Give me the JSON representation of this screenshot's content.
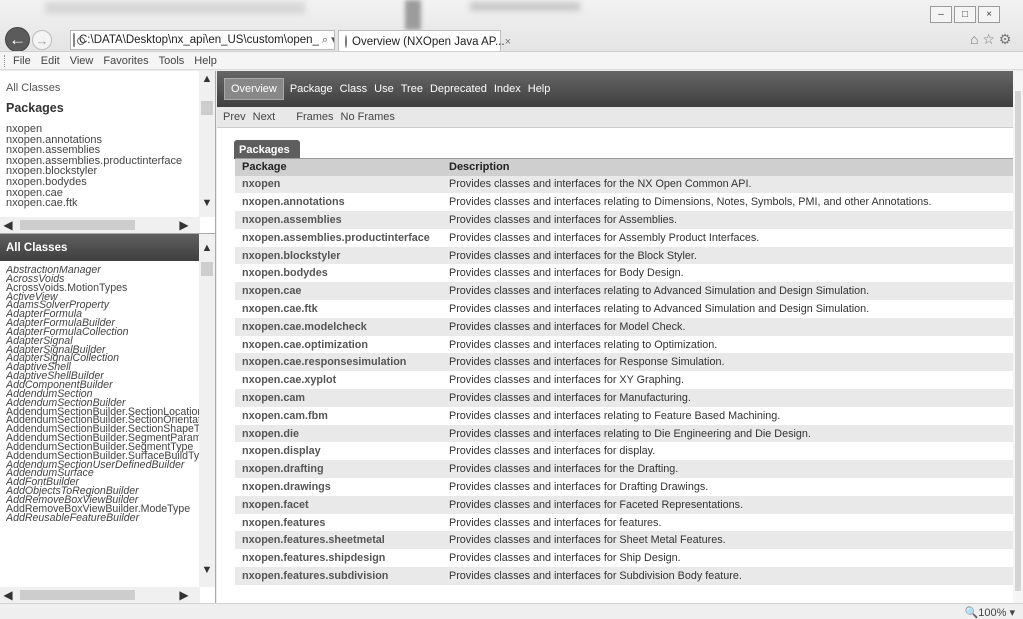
{
  "browser": {
    "address": "C:\\DATA\\Desktop\\nx_api\\en_US\\custom\\open_",
    "address_controls": "⌕ ▾ ↻",
    "tab_title": "Overview (NXOpen Java AP...",
    "tab_close": "×",
    "window_controls": [
      "–",
      "□",
      "×"
    ],
    "right_icons": "⌂ ☆ ⚙"
  },
  "menu": [
    "File",
    "Edit",
    "View",
    "Favorites",
    "Tools",
    "Help"
  ],
  "packages_frame": {
    "all_classes_link": "All Classes",
    "heading": "Packages",
    "items": [
      "nxopen",
      "nxopen.annotations",
      "nxopen.assemblies",
      "nxopen.assemblies.productinterface",
      "nxopen.blockstyler",
      "nxopen.bodydes",
      "nxopen.cae",
      "nxopen.cae.ftk"
    ]
  },
  "classes_frame": {
    "heading": "All Classes",
    "items": [
      {
        "name": "AbstractionManager",
        "italic": true
      },
      {
        "name": "AcrossVoids",
        "italic": true
      },
      {
        "name": "AcrossVoids.MotionTypes",
        "italic": false
      },
      {
        "name": "ActiveView",
        "italic": true
      },
      {
        "name": "AdamsSolverProperty",
        "italic": true
      },
      {
        "name": "AdapterFormula",
        "italic": true
      },
      {
        "name": "AdapterFormulaBuilder",
        "italic": true
      },
      {
        "name": "AdapterFormulaCollection",
        "italic": true
      },
      {
        "name": "AdapterSignal",
        "italic": true
      },
      {
        "name": "AdapterSignalBuilder",
        "italic": true
      },
      {
        "name": "AdapterSignalCollection",
        "italic": true
      },
      {
        "name": "AdaptiveShell",
        "italic": true
      },
      {
        "name": "AdaptiveShellBuilder",
        "italic": true
      },
      {
        "name": "AddComponentBuilder",
        "italic": true
      },
      {
        "name": "AddendumSection",
        "italic": true
      },
      {
        "name": "AddendumSectionBuilder",
        "italic": true
      },
      {
        "name": "AddendumSectionBuilder.SectionLocation",
        "italic": false
      },
      {
        "name": "AddendumSectionBuilder.SectionOrientation",
        "italic": false
      },
      {
        "name": "AddendumSectionBuilder.SectionShapeType",
        "italic": false
      },
      {
        "name": "AddendumSectionBuilder.SegmentParameter",
        "italic": false
      },
      {
        "name": "AddendumSectionBuilder.SegmentType",
        "italic": false
      },
      {
        "name": "AddendumSectionBuilder.SurfaceBuildType",
        "italic": false
      },
      {
        "name": "AddendumSectionUserDefinedBuilder",
        "italic": true
      },
      {
        "name": "AddendumSurface",
        "italic": true
      },
      {
        "name": "AddFontBuilder",
        "italic": true
      },
      {
        "name": "AddObjectsToRegionBuilder",
        "italic": true
      },
      {
        "name": "AddRemoveBoxViewBuilder",
        "italic": true
      },
      {
        "name": "AddRemoveBoxViewBuilder.ModeType",
        "italic": false
      },
      {
        "name": "AddReusableFeatureBuilder",
        "italic": true
      }
    ]
  },
  "main": {
    "topnav": {
      "active": "Overview",
      "items": [
        "Package",
        "Class",
        "Use",
        "Tree",
        "Deprecated",
        "Index",
        "Help"
      ]
    },
    "subnav": {
      "prev": "Prev",
      "next": "Next",
      "frames": "Frames",
      "no_frames": "No Frames"
    },
    "caption": "Packages",
    "columns": [
      "Package",
      "Description"
    ],
    "rows": [
      {
        "package": "nxopen",
        "description": "Provides classes and interfaces for the NX Open Common API."
      },
      {
        "package": "nxopen.annotations",
        "description": "Provides classes and interfaces relating to Dimensions, Notes, Symbols, PMI, and other Annotations."
      },
      {
        "package": "nxopen.assemblies",
        "description": "Provides classes and interfaces for Assemblies."
      },
      {
        "package": "nxopen.assemblies.productinterface",
        "description": "Provides classes and interfaces for Assembly Product Interfaces."
      },
      {
        "package": "nxopen.blockstyler",
        "description": "Provides classes and interfaces for the Block Styler."
      },
      {
        "package": "nxopen.bodydes",
        "description": "Provides classes and interfaces for Body Design."
      },
      {
        "package": "nxopen.cae",
        "description": "Provides classes and interfaces relating to Advanced Simulation and Design Simulation."
      },
      {
        "package": "nxopen.cae.ftk",
        "description": "Provides classes and interfaces relating to Advanced Simulation and Design Simulation."
      },
      {
        "package": "nxopen.cae.modelcheck",
        "description": "Provides classes and interfaces for Model Check."
      },
      {
        "package": "nxopen.cae.optimization",
        "description": "Provides classes and interfaces relating to Optimization."
      },
      {
        "package": "nxopen.cae.responsesimulation",
        "description": "Provides classes and interfaces for Response Simulation."
      },
      {
        "package": "nxopen.cae.xyplot",
        "description": "Provides classes and interfaces for XY Graphing."
      },
      {
        "package": "nxopen.cam",
        "description": "Provides classes and interfaces for Manufacturing."
      },
      {
        "package": "nxopen.cam.fbm",
        "description": "Provides classes and interfaces relating to Feature Based Machining."
      },
      {
        "package": "nxopen.die",
        "description": "Provides classes and interfaces relating to Die Engineering and Die Design."
      },
      {
        "package": "nxopen.display",
        "description": "Provides classes and interfaces for display."
      },
      {
        "package": "nxopen.drafting",
        "description": "Provides classes and interfaces for the Drafting."
      },
      {
        "package": "nxopen.drawings",
        "description": "Provides classes and interfaces for Drafting Drawings."
      },
      {
        "package": "nxopen.facet",
        "description": "Provides classes and interfaces for Faceted Representations."
      },
      {
        "package": "nxopen.features",
        "description": "Provides classes and interfaces for features."
      },
      {
        "package": "nxopen.features.sheetmetal",
        "description": "Provides classes and interfaces for Sheet Metal Features."
      },
      {
        "package": "nxopen.features.shipdesign",
        "description": "Provides classes and interfaces for Ship Design."
      },
      {
        "package": "nxopen.features.subdivision",
        "description": "Provides classes and interfaces for Subdivision Body feature."
      }
    ]
  },
  "status": {
    "zoom": "🔍100%  ▾"
  }
}
